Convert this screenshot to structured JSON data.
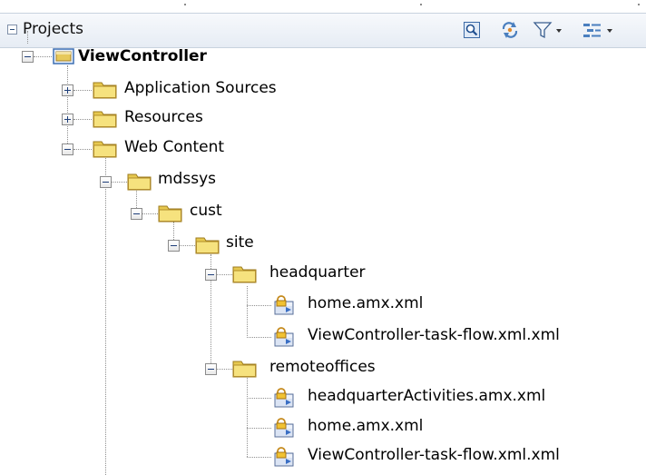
{
  "panel": {
    "title": "Projects",
    "toolbar": [
      {
        "name": "find-icon"
      },
      {
        "name": "sync-icon"
      },
      {
        "name": "filter-dropdown-icon"
      },
      {
        "name": "options-dropdown-icon"
      }
    ]
  },
  "tree": {
    "project": "ViewController",
    "application_sources": "Application Sources",
    "resources": "Resources",
    "web_content": "Web Content",
    "mdssys": "mdssys",
    "cust": "cust",
    "site": "site",
    "headquarter": "headquarter",
    "hq_file_1": "home.amx.xml",
    "hq_file_2": "ViewController-task-flow.xml.xml",
    "remoteoffices": "remoteoffices",
    "ro_file_1": "headquarterActivities.amx.xml",
    "ro_file_2": "home.amx.xml",
    "ro_file_3": "ViewController-task-flow.xml.xml"
  }
}
